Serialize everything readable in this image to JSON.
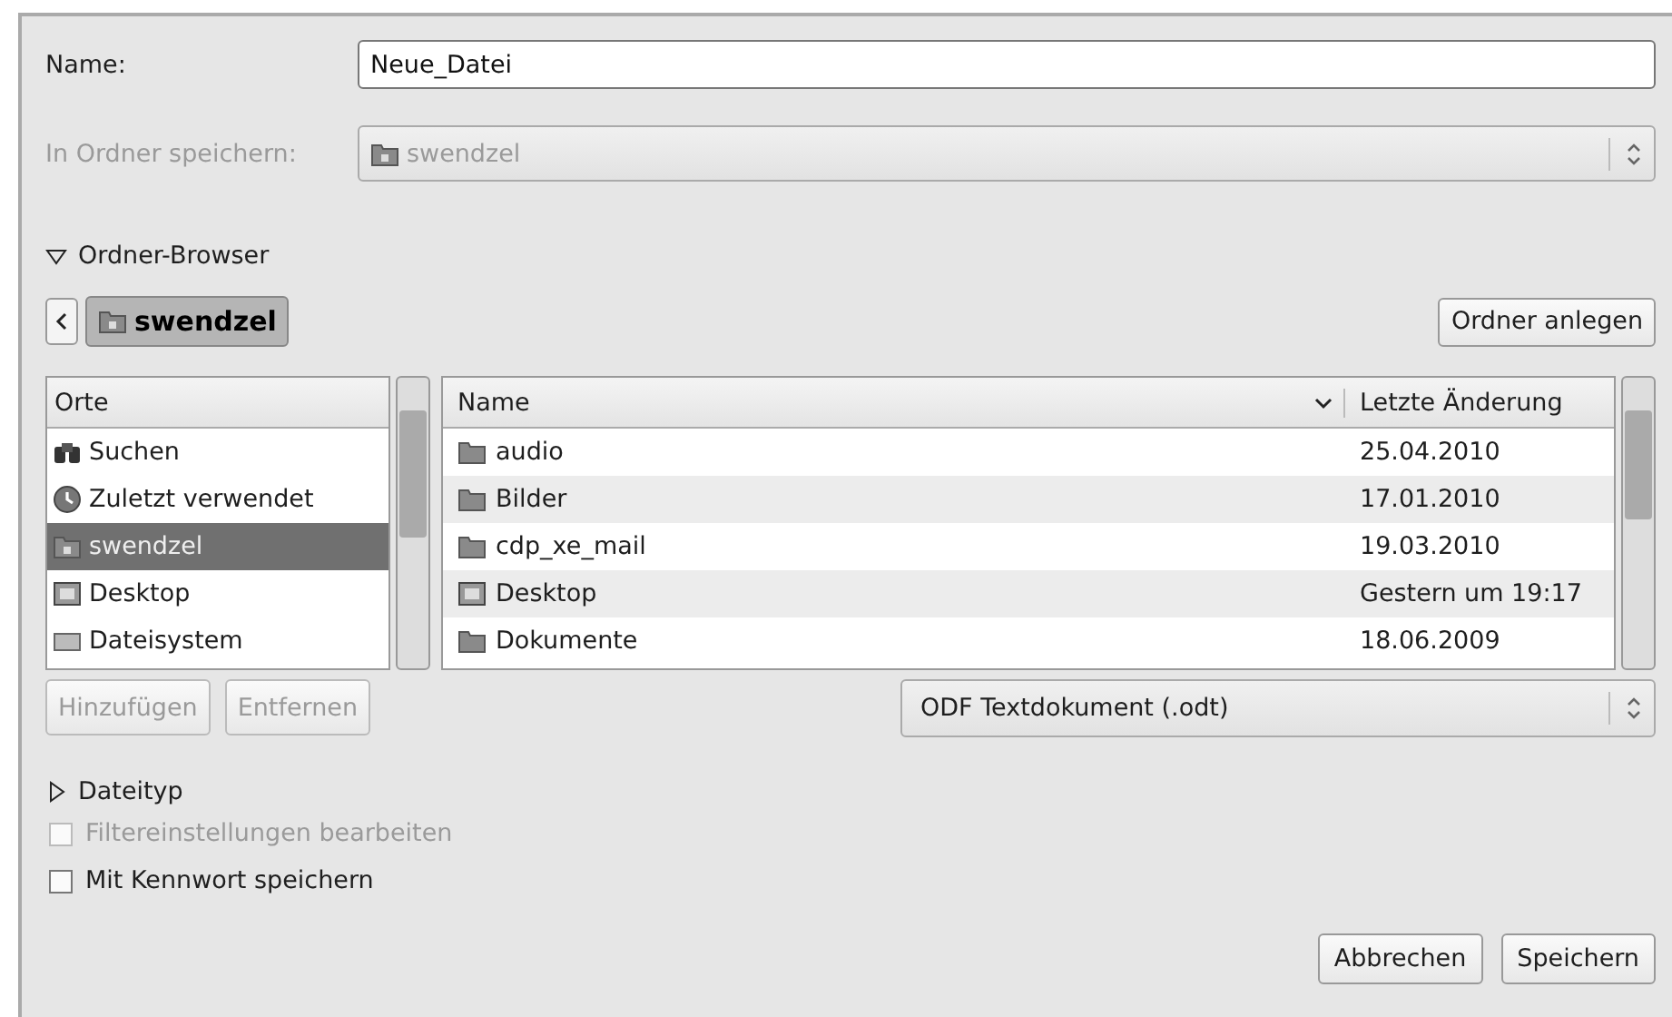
{
  "name_field": {
    "label": "Name:",
    "value": "Neue_Datei"
  },
  "folder_field": {
    "label": "In Ordner speichern:",
    "value": "swendzel",
    "disabled": true
  },
  "folder_browser": {
    "label": "Ordner-Browser",
    "expanded": true
  },
  "path_bar": {
    "crumb": "swendzel",
    "new_folder_button": "Ordner anlegen"
  },
  "places": {
    "header": "Orte",
    "items": [
      {
        "label": "Suchen",
        "kind": "search",
        "selected": false
      },
      {
        "label": "Zuletzt verwendet",
        "kind": "recent",
        "selected": false
      },
      {
        "label": "swendzel",
        "kind": "home",
        "selected": true
      },
      {
        "label": "Desktop",
        "kind": "desktop",
        "selected": false
      },
      {
        "label": "Dateisystem",
        "kind": "drive",
        "selected": false
      }
    ],
    "buttons": [
      {
        "label": "Hinzufügen",
        "disabled": true
      },
      {
        "label": "Entfernen",
        "disabled": true
      }
    ]
  },
  "files": {
    "columns": [
      "Name",
      "Letzte Änderung"
    ],
    "rows": [
      {
        "name": "audio",
        "kind": "folder",
        "modified": "25.04.2010"
      },
      {
        "name": "Bilder",
        "kind": "folder",
        "modified": "17.01.2010"
      },
      {
        "name": "cdp_xe_mail",
        "kind": "folder",
        "modified": "19.03.2010"
      },
      {
        "name": "Desktop",
        "kind": "desktop",
        "modified": "Gestern um 19:17"
      },
      {
        "name": "Dokumente",
        "kind": "folder",
        "modified": "18.06.2009"
      }
    ]
  },
  "filter": {
    "value": "ODF Textdokument (.odt)"
  },
  "file_type": {
    "label": "Dateityp",
    "expanded": false
  },
  "options": [
    {
      "label": "Filtereinstellungen bearbeiten",
      "checked": false,
      "disabled": true
    },
    {
      "label": "Mit Kennwort speichern",
      "checked": false,
      "disabled": false
    }
  ],
  "buttons": [
    "Abbrechen",
    "Speichern"
  ]
}
